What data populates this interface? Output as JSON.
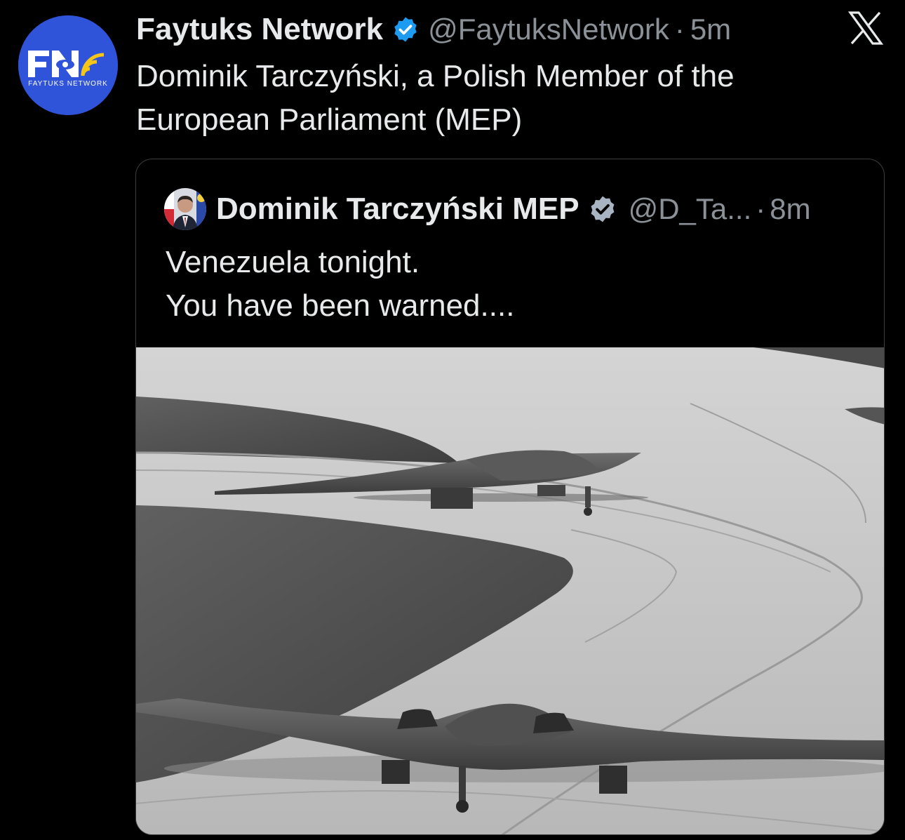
{
  "tweet": {
    "display_name": "Faytuks Network",
    "handle": "@FaytuksNetwork",
    "separator": "·",
    "time": "5m",
    "text_lines": [
      "Dominik Tarczyński, a Polish Member of the",
      "European Parliament (MEP)"
    ],
    "avatar": {
      "initials": "FN",
      "caption": "FAYTUKS NETWORK",
      "background": "#2f53d9"
    },
    "verified_icon": "verified-badge-icon",
    "platform_icon": "x-logo-icon"
  },
  "quoted_tweet": {
    "display_name": "Dominik Tarczyński MEP",
    "handle": "@D_Ta...",
    "separator": "·",
    "time": "8m",
    "text_lines": [
      "Venezuela tonight.",
      "You have been warned...."
    ],
    "media": {
      "kind": "photo",
      "subject": "stealth-bombers-on-taxiway"
    }
  },
  "colors": {
    "background": "#000000",
    "primary_text": "#e7e9ea",
    "secondary_text": "#8b9197",
    "verified": "#1d9bf0",
    "quote_border": "#3a3d40"
  }
}
